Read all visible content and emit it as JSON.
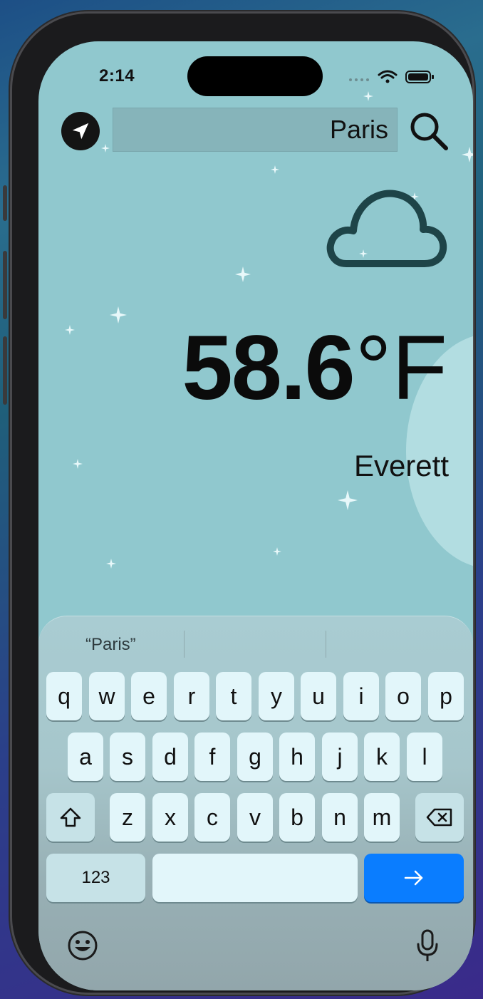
{
  "status_bar": {
    "time": "2:14"
  },
  "search": {
    "value": "Paris"
  },
  "weather": {
    "temperature": "58.6",
    "unit": "°F",
    "city": "Everett",
    "condition_icon": "cloud-icon"
  },
  "keyboard": {
    "suggestions": [
      "“Paris”",
      "",
      ""
    ],
    "row1": [
      "q",
      "w",
      "e",
      "r",
      "t",
      "y",
      "u",
      "i",
      "o",
      "p"
    ],
    "row2": [
      "a",
      "s",
      "d",
      "f",
      "g",
      "h",
      "j",
      "k",
      "l"
    ],
    "row3": [
      "z",
      "x",
      "c",
      "v",
      "b",
      "n",
      "m"
    ],
    "numbers_label": "123",
    "space_label": "",
    "go_icon": "arrow-right-icon",
    "shift_icon": "shift-icon",
    "delete_icon": "delete-icon",
    "emoji_icon": "emoji-icon",
    "mic_icon": "microphone-icon"
  },
  "colors": {
    "sky": "#90c8ce",
    "moon": "#b2dde1",
    "go_key": "#0a7dff"
  }
}
